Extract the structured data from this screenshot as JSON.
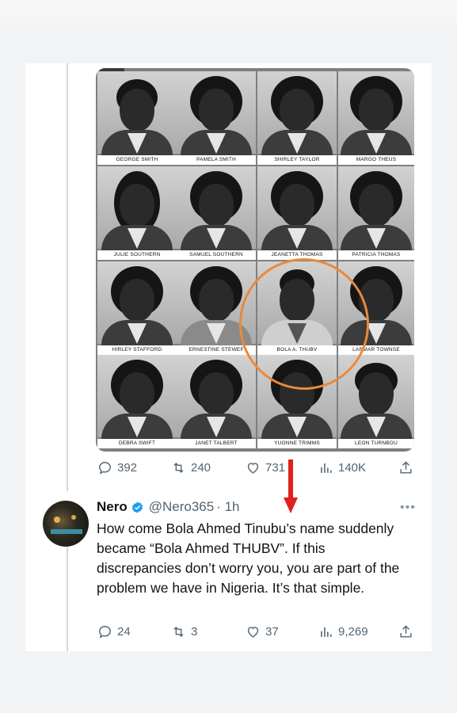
{
  "yearbook": {
    "names": [
      [
        "GEORGE SMITH",
        "PAMELA SMITH",
        "SHIRLEY TAYLOR",
        "MARGO THEUS"
      ],
      [
        "JULIE SOUTHERN",
        "SAMUEL SOUTHERN",
        "JEANETTA THOMAS",
        "PATRICIA THOMAS"
      ],
      [
        "HIRLEY STAFFORD",
        "ERNESTINE STEWEF",
        "BOLA A. THUBV",
        "LARMAR TOWNSE"
      ],
      [
        "DEBRA SWIFT",
        "JANET TALBERT",
        "YUONNE TRIMMS",
        "LEON TURNBOU"
      ]
    ],
    "highlight_color": "#e98a3a"
  },
  "quoted_metrics": {
    "replies": "392",
    "reposts": "240",
    "likes": "731",
    "views": "140K"
  },
  "reply": {
    "name": "Nero",
    "handle": "@Nero365",
    "time": "· 1h",
    "text": "How come Bola Ahmed Tinubu’s name suddenly became “Bola Ahmed THUBV”. If this discrepancies don’t worry you, you are part of the problem we have in Nigeria. It’s that simple.",
    "metrics": {
      "replies": "24",
      "reposts": "3",
      "likes": "37",
      "views": "9,269"
    }
  },
  "colors": {
    "text": "#0f1419",
    "secondary": "#536471",
    "verified": "#1d9bf0",
    "arrow": "#e0201c"
  },
  "icons": [
    "reply-icon",
    "repost-icon",
    "like-icon",
    "views-icon",
    "share-icon",
    "verified-icon",
    "more-icon"
  ]
}
